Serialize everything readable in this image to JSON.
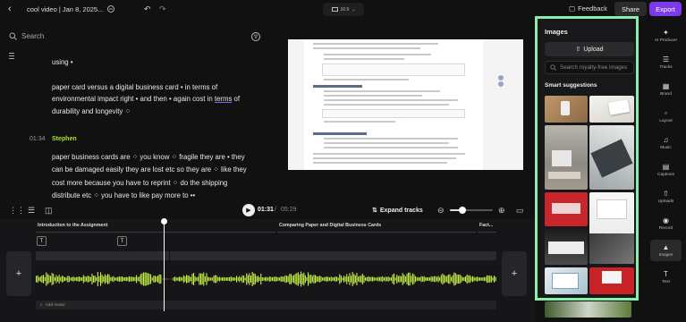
{
  "topbar": {
    "project_title": "cool video | Jan 8, 2025...",
    "aspect_label": "16:9",
    "feedback_label": "Feedback",
    "share_label": "Share",
    "export_label": "Export"
  },
  "transcript": {
    "search_placeholder": "Search",
    "lines": [
      "using •",
      "paper card versus a digital business card • in terms of",
      "environmental impact right • and then • again cost in ",
      "terms",
      " of",
      "durability and longevity ⁘"
    ],
    "block2": {
      "timestamp": "01:34",
      "speaker": "Stephen",
      "lines": [
        "paper business cards are ⁘ you know ⁘ fragile they are • they",
        "can be damaged easily they are lost etc so they are ⁘ like they",
        "cost more because you have to reprint ⁘ do the shipping",
        "distribute etc ⁘ you have to like pay more to ••"
      ]
    }
  },
  "player": {
    "current_time": "01:31",
    "separator": "/",
    "total_time": "05:29",
    "expand_label": "Expand tracks",
    "zoom_level": 0.3
  },
  "timeline": {
    "chapters": [
      "Introduction to the Assignment",
      "Comparing Paper and Digital Business Cards",
      "Fact..."
    ],
    "text_marker": "T",
    "add_music_label": "Add music",
    "playhead_progress": 0.276
  },
  "images_panel": {
    "title": "Images",
    "upload_label": "Upload",
    "search_placeholder": "Search royalty-free images",
    "suggestions_label": "Smart suggestions"
  },
  "right_sidebar": {
    "items": [
      {
        "label": "AI Producer",
        "icon": "sparkle-icon"
      },
      {
        "label": "Tracks",
        "icon": "tracks-icon"
      },
      {
        "label": "Brand",
        "icon": "brand-icon"
      },
      {
        "label": "Layout",
        "icon": "layout-icon"
      },
      {
        "label": "Music",
        "icon": "music-icon"
      },
      {
        "label": "Captions",
        "icon": "captions-icon"
      },
      {
        "label": "Uploads",
        "icon": "upload-icon"
      },
      {
        "label": "Record",
        "icon": "record-icon"
      },
      {
        "label": "Images",
        "icon": "image-icon"
      },
      {
        "label": "Text",
        "icon": "text-icon"
      }
    ],
    "active": "Images"
  },
  "colors": {
    "accent": "#7c3aed",
    "waveform": "#c8f04a",
    "highlight_border": "#86efac",
    "speaker": "#a3e635"
  }
}
